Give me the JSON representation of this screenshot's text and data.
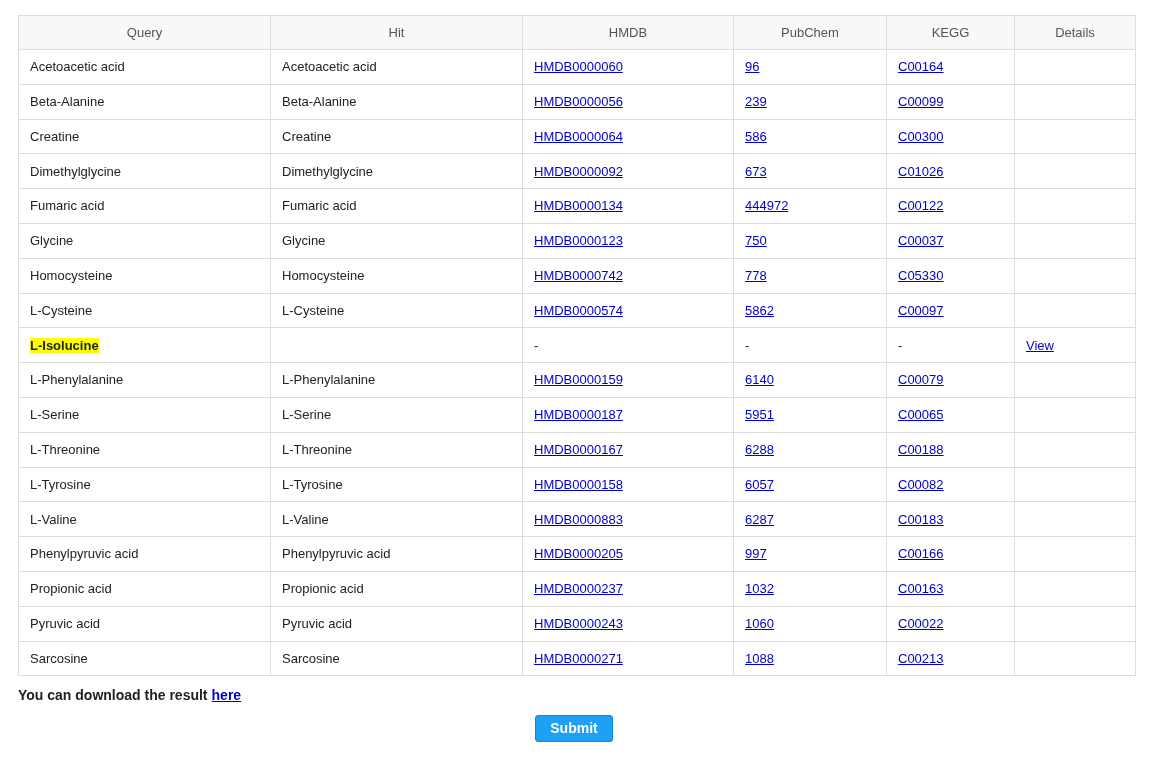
{
  "table": {
    "columns": [
      "Query",
      "Hit",
      "HMDB",
      "PubChem",
      "KEGG",
      "Details"
    ],
    "rows": [
      {
        "query": "Acetoacetic acid",
        "hit": "Acetoacetic acid",
        "hmdb": "HMDB0000060",
        "pubchem": "96",
        "kegg": "C00164",
        "matched": true
      },
      {
        "query": "Beta-Alanine",
        "hit": "Beta-Alanine",
        "hmdb": "HMDB0000056",
        "pubchem": "239",
        "kegg": "C00099",
        "matched": true
      },
      {
        "query": "Creatine",
        "hit": "Creatine",
        "hmdb": "HMDB0000064",
        "pubchem": "586",
        "kegg": "C00300",
        "matched": true
      },
      {
        "query": "Dimethylglycine",
        "hit": "Dimethylglycine",
        "hmdb": "HMDB0000092",
        "pubchem": "673",
        "kegg": "C01026",
        "matched": true
      },
      {
        "query": "Fumaric acid",
        "hit": "Fumaric acid",
        "hmdb": "HMDB0000134",
        "pubchem": "444972",
        "kegg": "C00122",
        "matched": true
      },
      {
        "query": "Glycine",
        "hit": "Glycine",
        "hmdb": "HMDB0000123",
        "pubchem": "750",
        "kegg": "C00037",
        "matched": true
      },
      {
        "query": "Homocysteine",
        "hit": "Homocysteine",
        "hmdb": "HMDB0000742",
        "pubchem": "778",
        "kegg": "C05330",
        "matched": true
      },
      {
        "query": "L-Cysteine",
        "hit": "L-Cysteine",
        "hmdb": "HMDB0000574",
        "pubchem": "5862",
        "kegg": "C00097",
        "matched": true
      },
      {
        "query": "L-Isolucine",
        "hmdb": "-",
        "pubchem": "-",
        "kegg": "-",
        "details": "View",
        "matched": false
      },
      {
        "query": "L-Phenylalanine",
        "hit": "L-Phenylalanine",
        "hmdb": "HMDB0000159",
        "pubchem": "6140",
        "kegg": "C00079",
        "matched": true
      },
      {
        "query": "L-Serine",
        "hit": "L-Serine",
        "hmdb": "HMDB0000187",
        "pubchem": "5951",
        "kegg": "C00065",
        "matched": true
      },
      {
        "query": "L-Threonine",
        "hit": "L-Threonine",
        "hmdb": "HMDB0000167",
        "pubchem": "6288",
        "kegg": "C00188",
        "matched": true
      },
      {
        "query": "L-Tyrosine",
        "hit": "L-Tyrosine",
        "hmdb": "HMDB0000158",
        "pubchem": "6057",
        "kegg": "C00082",
        "matched": true
      },
      {
        "query": "L-Valine",
        "hit": "L-Valine",
        "hmdb": "HMDB0000883",
        "pubchem": "6287",
        "kegg": "C00183",
        "matched": true
      },
      {
        "query": "Phenylpyruvic acid",
        "hit": "Phenylpyruvic acid",
        "hmdb": "HMDB0000205",
        "pubchem": "997",
        "kegg": "C00166",
        "matched": true
      },
      {
        "query": "Propionic acid",
        "hit": "Propionic acid",
        "hmdb": "HMDB0000237",
        "pubchem": "1032",
        "kegg": "C00163",
        "matched": true
      },
      {
        "query": "Pyruvic acid",
        "hit": "Pyruvic acid",
        "hmdb": "HMDB0000243",
        "pubchem": "1060",
        "kegg": "C00022",
        "matched": true
      },
      {
        "query": "Sarcosine",
        "hit": "Sarcosine",
        "hmdb": "HMDB0000271",
        "pubchem": "1088",
        "kegg": "C00213",
        "matched": true
      }
    ]
  },
  "download": {
    "text": "You can download the result",
    "link": "here"
  },
  "submit": "Submit"
}
